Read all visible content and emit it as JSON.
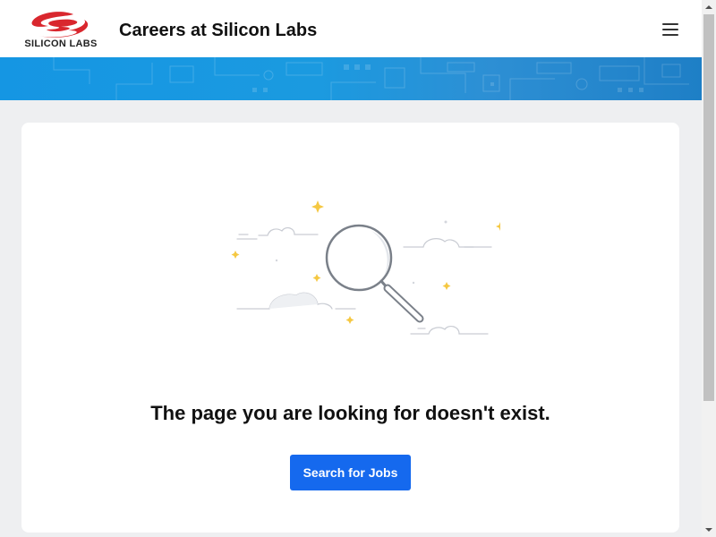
{
  "header": {
    "logo_text": "SILICON LABS",
    "title": "Careers at Silicon Labs",
    "menu_icon": "hamburger-menu-icon"
  },
  "banner": {
    "pattern": "circuit-board-pattern"
  },
  "main": {
    "illustration": "magnifying-glass-illustration",
    "message": "The page you are looking for doesn't exist.",
    "button_label": "Search for Jobs"
  },
  "colors": {
    "brand_red": "#d9272e",
    "banner_blue": "#1a98e1",
    "button_blue": "#1569ee",
    "background": "#eeeff1",
    "sparkle": "#f5c842"
  }
}
